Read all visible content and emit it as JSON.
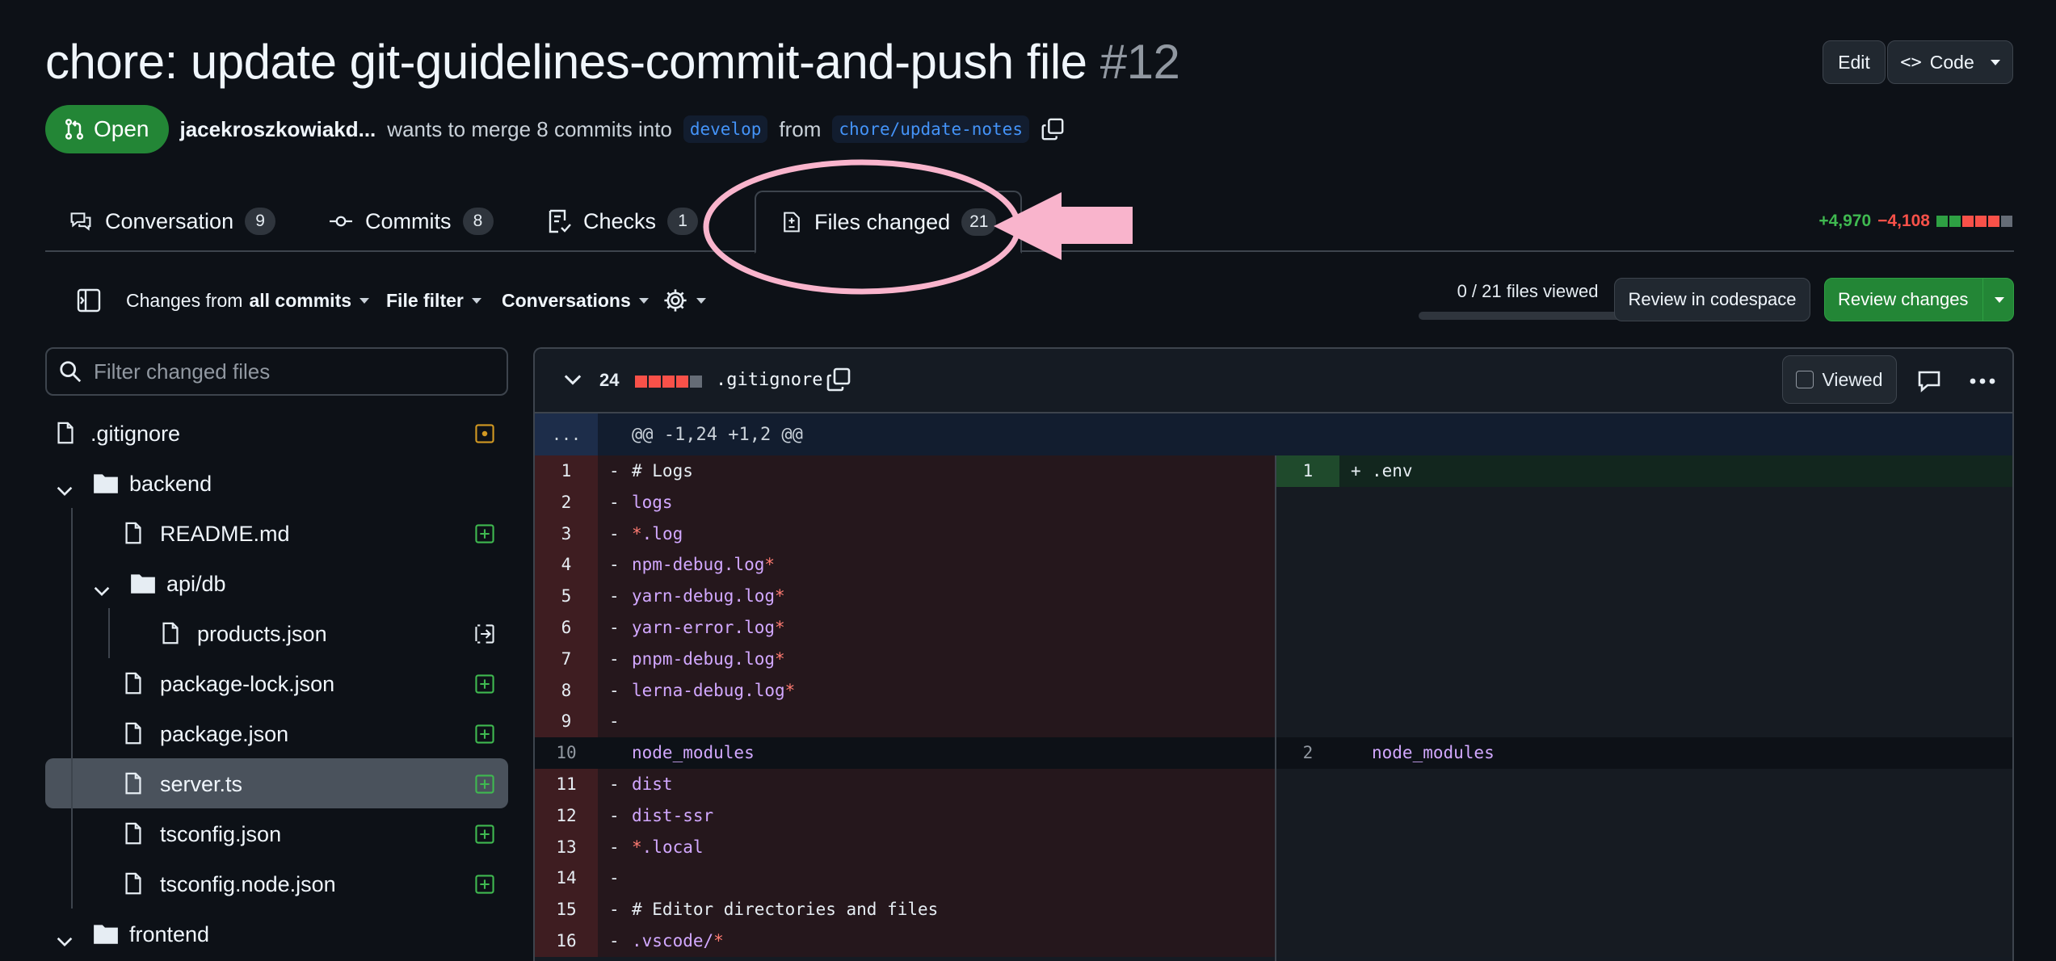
{
  "pr": {
    "title": "chore: update git-guidelines-commit-and-push file",
    "number": "#12",
    "edit_label": "Edit",
    "code_label": "Code",
    "status": "Open",
    "author": "jacekroszkowiakd...",
    "merge_text": "wants to merge 8 commits into",
    "base_branch": "develop",
    "from_text": "from",
    "head_branch": "chore/update-notes"
  },
  "tabs": [
    {
      "label": "Conversation",
      "count": "9",
      "icon": "comment-discussion-icon"
    },
    {
      "label": "Commits",
      "count": "8",
      "icon": "git-commit-icon"
    },
    {
      "label": "Checks",
      "count": "1",
      "icon": "checklist-icon"
    },
    {
      "label": "Files changed",
      "count": "21",
      "icon": "file-diff-icon",
      "active": true
    }
  ],
  "diffstat": {
    "additions": "+4,970",
    "deletions": "−4,108",
    "blocks": [
      "#2ea043",
      "#2ea043",
      "#f85149",
      "#f85149",
      "#f85149",
      "#656c76"
    ]
  },
  "toolbar": {
    "changes_prefix": "Changes from",
    "changes_value": "all commits",
    "file_filter": "File filter",
    "conversations": "Conversations",
    "viewed_count": "0 / 21 files viewed",
    "viewed_fraction": 0,
    "review_codespace": "Review in codespace",
    "review_changes": "Review changes"
  },
  "sidebar": {
    "filter_placeholder": "Filter changed files",
    "items": [
      {
        "name": ".gitignore",
        "kind": "file",
        "status": "modified"
      },
      {
        "name": "backend",
        "kind": "folder"
      },
      {
        "name": "README.md",
        "kind": "file",
        "status": "added"
      },
      {
        "name": "api/db",
        "kind": "folder"
      },
      {
        "name": "products.json",
        "kind": "file",
        "status": "renamed"
      },
      {
        "name": "package-lock.json",
        "kind": "file",
        "status": "added"
      },
      {
        "name": "package.json",
        "kind": "file",
        "status": "added"
      },
      {
        "name": "server.ts",
        "kind": "file",
        "status": "added",
        "selected": true
      },
      {
        "name": "tsconfig.json",
        "kind": "file",
        "status": "added"
      },
      {
        "name": "tsconfig.node.json",
        "kind": "file",
        "status": "added"
      },
      {
        "name": "frontend",
        "kind": "folder"
      }
    ]
  },
  "file_diff": {
    "changes": "24",
    "filename": ".gitignore",
    "viewed_label": "Viewed",
    "hunk_header": "@@ -1,24 +1,2 @@",
    "hunk_expand": "...",
    "left_lines": [
      {
        "n": "1",
        "type": "del",
        "text": "# Logs"
      },
      {
        "n": "2",
        "type": "del",
        "text": "logs"
      },
      {
        "n": "3",
        "type": "del",
        "text": "*.log"
      },
      {
        "n": "4",
        "type": "del",
        "text": "npm-debug.log*"
      },
      {
        "n": "5",
        "type": "del",
        "text": "yarn-debug.log*"
      },
      {
        "n": "6",
        "type": "del",
        "text": "yarn-error.log*"
      },
      {
        "n": "7",
        "type": "del",
        "text": "pnpm-debug.log*"
      },
      {
        "n": "8",
        "type": "del",
        "text": "lerna-debug.log*"
      },
      {
        "n": "9",
        "type": "del",
        "text": ""
      },
      {
        "n": "10",
        "type": "ctx",
        "text": "node_modules"
      },
      {
        "n": "11",
        "type": "del",
        "text": "dist"
      },
      {
        "n": "12",
        "type": "del",
        "text": "dist-ssr"
      },
      {
        "n": "13",
        "type": "del",
        "text": "*.local"
      },
      {
        "n": "14",
        "type": "del",
        "text": ""
      },
      {
        "n": "15",
        "type": "del",
        "text": "# Editor directories and files"
      },
      {
        "n": "16",
        "type": "del",
        "text": ".vscode/*"
      }
    ],
    "right_lines": [
      {
        "n": "1",
        "type": "add",
        "text": ".env"
      },
      {
        "n": "",
        "type": "empty",
        "text": ""
      },
      {
        "n": "",
        "type": "empty",
        "text": ""
      },
      {
        "n": "",
        "type": "empty",
        "text": ""
      },
      {
        "n": "",
        "type": "empty",
        "text": ""
      },
      {
        "n": "",
        "type": "empty",
        "text": ""
      },
      {
        "n": "",
        "type": "empty",
        "text": ""
      },
      {
        "n": "",
        "type": "empty",
        "text": ""
      },
      {
        "n": "",
        "type": "empty",
        "text": ""
      },
      {
        "n": "2",
        "type": "ctx",
        "text": "node_modules"
      },
      {
        "n": "",
        "type": "empty",
        "text": ""
      },
      {
        "n": "",
        "type": "empty",
        "text": ""
      },
      {
        "n": "",
        "type": "empty",
        "text": ""
      },
      {
        "n": "",
        "type": "empty",
        "text": ""
      },
      {
        "n": "",
        "type": "empty",
        "text": ""
      },
      {
        "n": "",
        "type": "empty",
        "text": ""
      }
    ]
  },
  "colors": {
    "background": "#0d1117",
    "accent_green": "#238636",
    "link_blue": "#4493f8",
    "annotation_pink": "#f9b4cc"
  }
}
